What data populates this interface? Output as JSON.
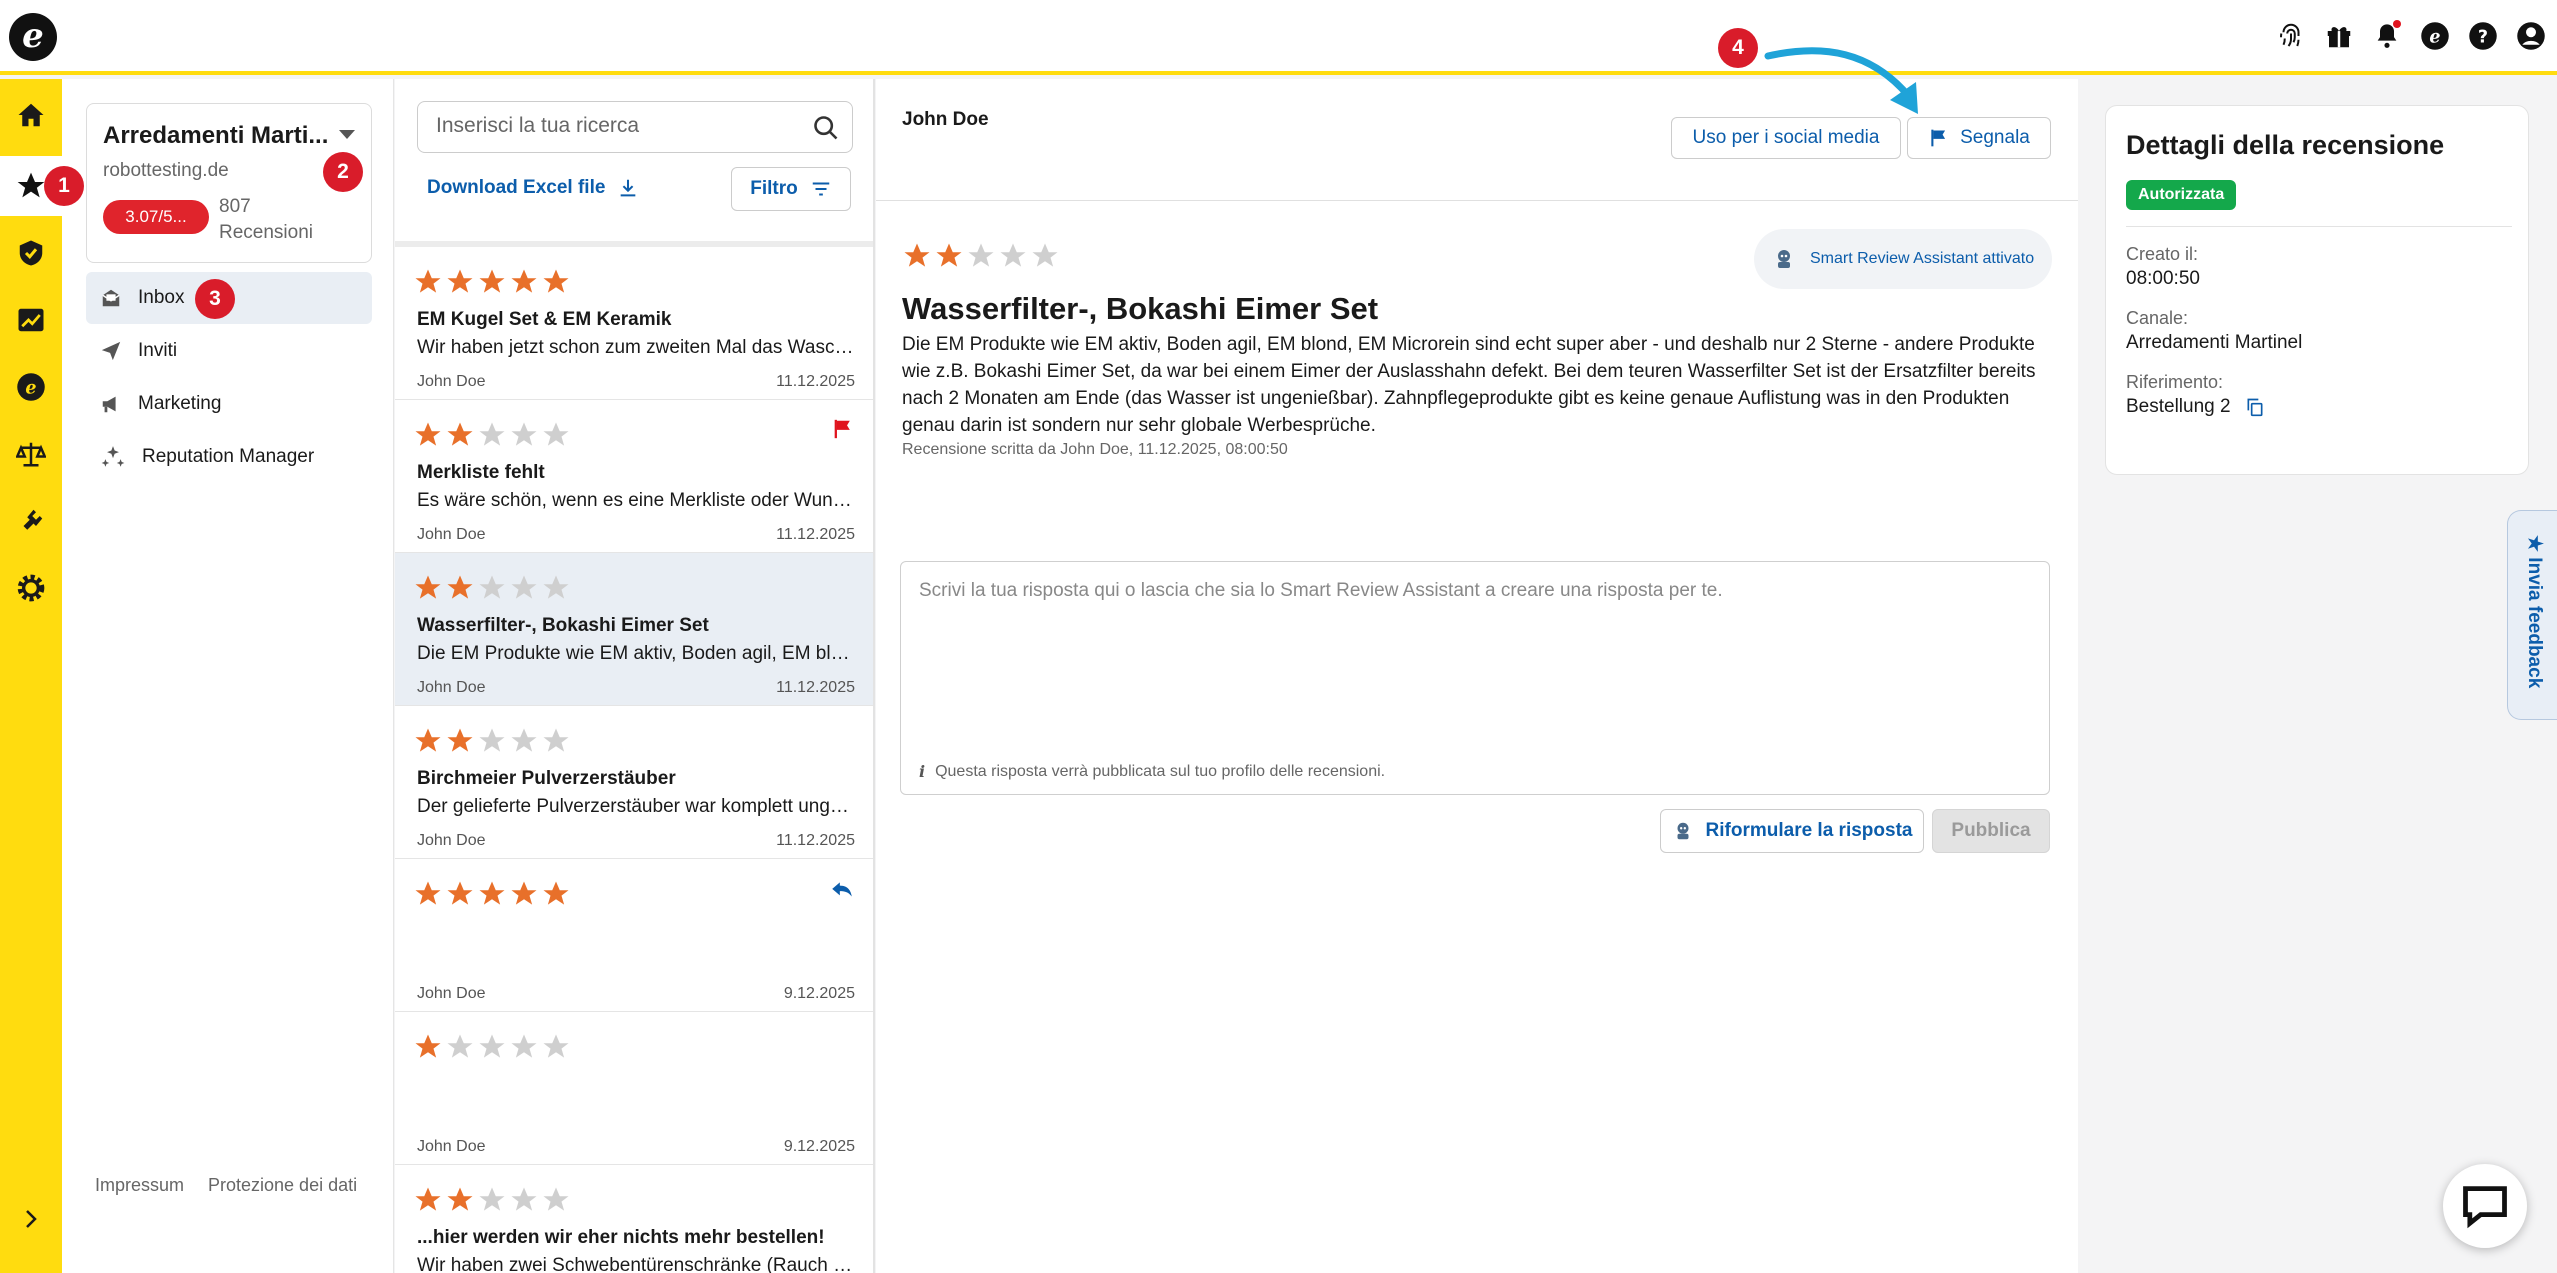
{
  "app": {
    "logo_letter": "e",
    "brand_color": "#ffdc0f",
    "accent_color": "#0c5dab"
  },
  "topbar": {
    "icons": [
      "fingerprint-icon",
      "gift-icon",
      "bell-icon",
      "etrusted-icon",
      "help-icon",
      "account-icon"
    ]
  },
  "rail": {
    "items": [
      "home-icon",
      "star-icon",
      "shield-icon",
      "analytics-icon",
      "etrusted-icon",
      "legal-icon",
      "plugin-icon",
      "settings-icon"
    ],
    "active": "star-icon"
  },
  "annotations": {
    "b1": "1",
    "b2": "2",
    "b3": "3",
    "b4": "4"
  },
  "account": {
    "name": "Arredamenti Marti...",
    "domain": "robottesting.de",
    "score": "3.07/5...",
    "review_count": "807 Recensioni"
  },
  "nav": {
    "items": [
      {
        "label": "Inbox",
        "icon": "inbox-icon"
      },
      {
        "label": "Inviti",
        "icon": "send-icon"
      },
      {
        "label": "Marketing",
        "icon": "megaphone-icon"
      },
      {
        "label": "Reputation Manager",
        "icon": "sparkle-icon"
      }
    ],
    "footer_impressum": "Impressum",
    "footer_privacy": "Protezione dei dati"
  },
  "list": {
    "search_placeholder": "Inserisci la tua ricerca",
    "download_label": "Download Excel file",
    "filter_label": "Filtro",
    "items": [
      {
        "rating": 5,
        "title": "EM Kugel Set & EM Keramik",
        "excerpt": "Wir haben jetzt schon zum zweiten Mal das Wasch...",
        "author": "John Doe",
        "date": "11.12.2025",
        "flag": false,
        "reply": false
      },
      {
        "rating": 2,
        "title": "Merkliste fehlt",
        "excerpt": "Es wäre schön, wenn es eine Merkliste oder Wunsc...",
        "author": "John Doe",
        "date": "11.12.2025",
        "flag": true,
        "reply": false
      },
      {
        "rating": 2,
        "title": "Wasserfilter-, Bokashi Eimer Set",
        "excerpt": "Die EM Produkte wie EM aktiv, Boden agil, EM blon...",
        "author": "John Doe",
        "date": "11.12.2025",
        "flag": false,
        "reply": false
      },
      {
        "rating": 2,
        "title": "Birchmeier Pulverzerstäuber",
        "excerpt": "Der gelieferte Pulverzerstäuber war komplett ungee...",
        "author": "John Doe",
        "date": "11.12.2025",
        "flag": false,
        "reply": false
      },
      {
        "rating": 5,
        "title": "",
        "excerpt": "",
        "author": "John Doe",
        "date": "9.12.2025",
        "flag": false,
        "reply": true
      },
      {
        "rating": 1,
        "title": "",
        "excerpt": "",
        "author": "John Doe",
        "date": "9.12.2025",
        "flag": false,
        "reply": false
      },
      {
        "rating": 2,
        "title": "...hier werden wir eher nichts mehr bestellen!",
        "excerpt": "Wir haben zwei Schwebentürenschränke (Rauch Qu...",
        "author": "",
        "date": "",
        "flag": false,
        "reply": false
      }
    ],
    "selected_index": 2
  },
  "detail": {
    "author": "John Doe",
    "social_button": "Uso per i social media",
    "report_button": "Segnala",
    "assistant_chip": "Smart Review Assistant attivato",
    "rating": 2,
    "title": "Wasserfilter-, Bokashi Eimer Set",
    "text": "Die EM Produkte wie EM aktiv, Boden agil, EM blond, EM Microrein sind echt super aber - und deshalb nur 2 Sterne - andere Produkte wie z.B. Bokashi Eimer Set, da war bei einem Eimer der Auslasshahn defekt. Bei dem teuren Wasserfilter Set ist der Ersatzfilter bereits nach 2 Monaten am Ende (das Wasser ist ungenießbar). Zahnpflegeprodukte gibt es keine genaue Auflistung was in den Produkten genau darin ist sondern nur sehr globale Werbesprüche.",
    "meta": "Recensione scritta da John Doe, 11.12.2025, 08:00:50",
    "reply_placeholder": "Scrivi la tua risposta qui o lascia che sia lo Smart Review Assistant a creare una risposta per te.",
    "reply_hint": "Questa risposta verrà pubblicata sul tuo profilo delle recensioni.",
    "rephrase_button": "Riformulare la risposta",
    "publish_button": "Pubblica"
  },
  "side": {
    "title": "Dettagli della recensione",
    "status": "Autorizzata",
    "created_label": "Creato il:",
    "created_value": "08:00:50",
    "channel_label": "Canale:",
    "channel_value": "Arredamenti Martinel",
    "reference_label": "Riferimento:",
    "reference_value": "Bestellung 2"
  },
  "feedback": {
    "label": "★ Invia feedback"
  }
}
